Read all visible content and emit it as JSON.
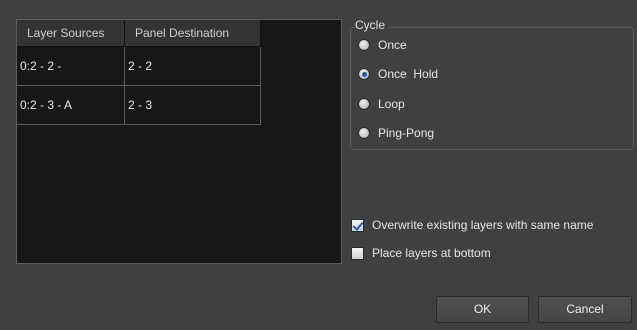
{
  "table": {
    "headers": [
      "Layer Sources",
      "Panel Destination"
    ],
    "rows": [
      {
        "source": "0:2 - 2 -",
        "destination": "2 - 2"
      },
      {
        "source": "0:2 - 3 - A",
        "destination": "2 - 3"
      }
    ]
  },
  "cycle": {
    "title": "Cycle",
    "options": [
      {
        "label": "Once",
        "checked": false
      },
      {
        "label": "Once  Hold",
        "checked": true
      },
      {
        "label": "Loop",
        "checked": false
      },
      {
        "label": "Ping-Pong",
        "checked": false
      }
    ]
  },
  "options": {
    "overwrite_label": "Overwrite existing layers with same name",
    "overwrite_checked": true,
    "bottom_label": "Place layers at bottom",
    "bottom_checked": false
  },
  "buttons": {
    "ok_label": "OK",
    "cancel_label": "Cancel"
  },
  "colors": {
    "background": "#404040",
    "table_background": "#171717",
    "accent": "#1f5fb0"
  }
}
